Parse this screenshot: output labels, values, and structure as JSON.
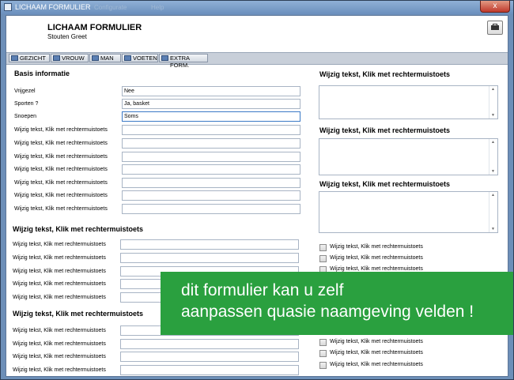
{
  "window": {
    "title": "LICHAAM FORMULIER",
    "faded_title": "Configurate",
    "faded_title2": "Help",
    "close_glyph": "x"
  },
  "header": {
    "title": "LICHAAM FORMULIER",
    "subtitle": "Stouten Greet"
  },
  "tabs": [
    {
      "label": "GEZICHT"
    },
    {
      "label": "VROUW"
    },
    {
      "label": "MAN"
    },
    {
      "label": "VOETEN"
    },
    {
      "label": "EXTRA FORM."
    }
  ],
  "basis": {
    "title": "Basis informatie",
    "fields": [
      {
        "label": "Vrijgezel",
        "value": "Nee"
      },
      {
        "label": "Sporten ?",
        "value": "Ja, basket"
      },
      {
        "label": "Snoepen",
        "value": "Soms"
      },
      {
        "label": "Wijzig tekst, Klik met rechtermuistoets",
        "value": ""
      },
      {
        "label": "Wijzig tekst, Klik met rechtermuistoets",
        "value": ""
      },
      {
        "label": "Wijzig tekst, Klik met rechtermuistoets",
        "value": ""
      },
      {
        "label": "Wijzig tekst, Klik met rechtermuistoets",
        "value": ""
      },
      {
        "label": "Wijzig tekst, Klik met rechtermuistoets",
        "value": ""
      },
      {
        "label": "Wijzig tekst, Klik met rechtermuistoets",
        "value": ""
      },
      {
        "label": "Wijzig tekst, Klik met rechtermuistoets",
        "value": ""
      }
    ]
  },
  "section2": {
    "title": "Wijzig tekst, Klik met rechtermuistoets",
    "fields": [
      {
        "label": "Wijzig tekst, Klik met rechtermuistoets",
        "value": ""
      },
      {
        "label": "Wijzig tekst, Klik met rechtermuistoets",
        "value": ""
      },
      {
        "label": "Wijzig tekst, Klik met rechtermuistoets",
        "value": ""
      },
      {
        "label": "Wijzig tekst, Klik met rechtermuistoets",
        "value": ""
      },
      {
        "label": "Wijzig tekst, Klik met rechtermuistoets",
        "value": ""
      }
    ]
  },
  "section3": {
    "title": "Wijzig tekst, Klik met rechtermuistoets",
    "fields": [
      {
        "label": "Wijzig tekst, Klik met rechtermuistoets",
        "value": ""
      },
      {
        "label": "Wijzig tekst, Klik met rechtermuistoets",
        "value": ""
      },
      {
        "label": "Wijzig tekst, Klik met rechtermuistoets",
        "value": ""
      },
      {
        "label": "Wijzig tekst, Klik met rechtermuistoets",
        "value": ""
      }
    ]
  },
  "right": {
    "textareas": [
      {
        "title": "Wijzig tekst, Klik met rechtermuistoets"
      },
      {
        "title": "Wijzig tekst, Klik met rechtermuistoets"
      },
      {
        "title": "Wijzig tekst, Klik met rechtermuistoets"
      }
    ],
    "checkboxes_top": [
      {
        "label": "Wijzig tekst, Klik met rechtermuistoets",
        "checked": false
      },
      {
        "label": "Wijzig tekst, Klik met rechtermuistoets",
        "checked": false
      },
      {
        "label": "Wijzig tekst, Klik met rechtermuistoets",
        "checked": false
      }
    ],
    "checkboxes_bottom": [
      {
        "label": "Wijzig tekst, Klik met rechtermuistoets",
        "checked": false
      },
      {
        "label": "Wijzig tekst, Klik met rechtermuistoets",
        "checked": false
      },
      {
        "label": "Wijzig tekst, Klik met rechtermuistoets",
        "checked": false
      }
    ]
  },
  "overlay": {
    "line1": "dit formulier kan u zelf",
    "line2": "aanpassen quasie naamgeving velden !"
  },
  "colors": {
    "overlay_bg": "#2aa03f",
    "titlebar": "#6b8fbd",
    "close": "#c0392b"
  }
}
